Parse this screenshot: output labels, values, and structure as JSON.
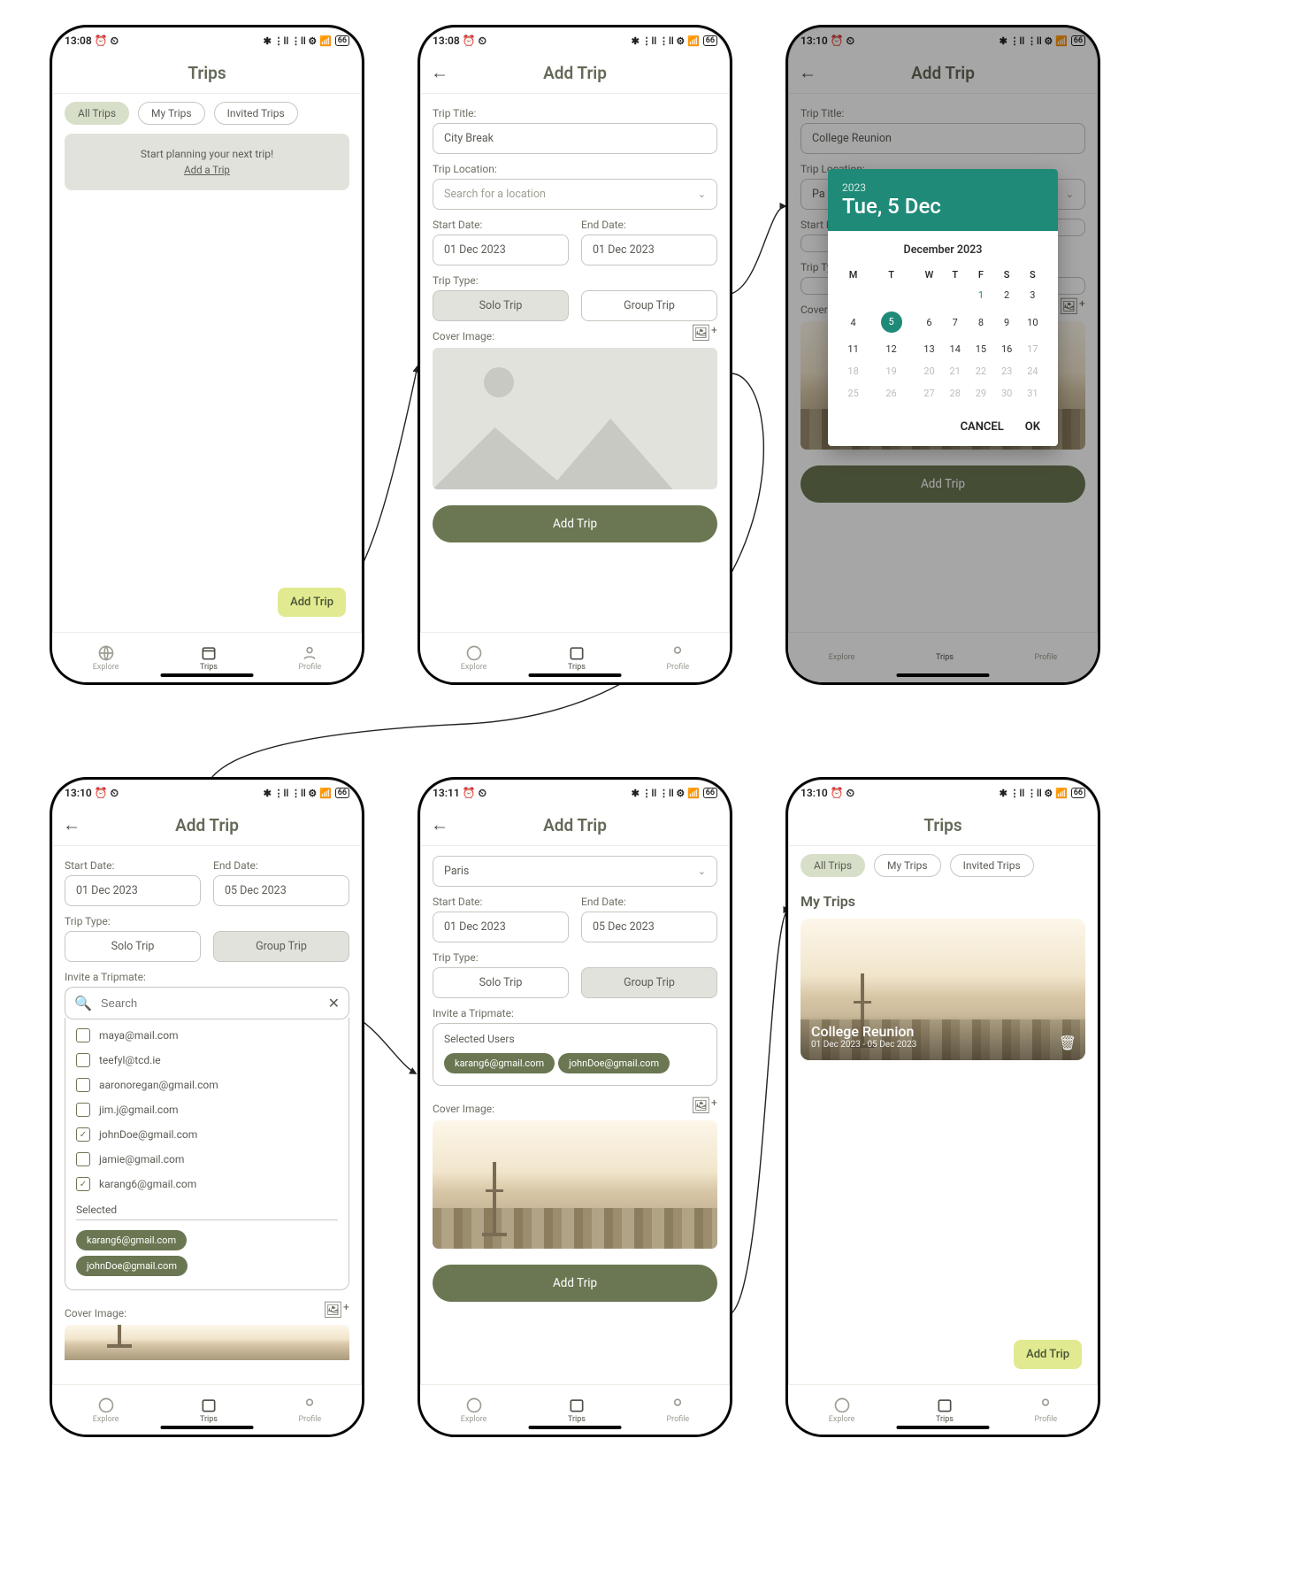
{
  "status": {
    "time1": "13:08",
    "time2": "13:10",
    "time3": "13:11",
    "battery": "66"
  },
  "nav": {
    "explore": "Explore",
    "trips": "Trips",
    "profile": "Profile"
  },
  "trips": {
    "title": "Trips",
    "tabs": {
      "all": "All Trips",
      "my": "My Trips",
      "invited": "Invited Trips"
    },
    "empty_headline": "Start planning your next trip!",
    "empty_link": "Add a Trip",
    "fab": "Add Trip",
    "my_heading": "My Trips",
    "card": {
      "title": "College Reunion",
      "dates": "01 Dec 2023 - 05 Dec 2023"
    }
  },
  "add": {
    "title": "Add Trip",
    "labels": {
      "trip_title": "Trip Title:",
      "trip_location": "Trip Location:",
      "start": "Start Date:",
      "end": "End Date:",
      "type": "Trip Type:",
      "cover": "Cover Image:",
      "invite": "Invite a Tripmate:"
    },
    "values": {
      "title_s2": "City Break",
      "title_s3": "College Reunion",
      "location_placeholder": "Search for a location",
      "location_paris": "Paris",
      "date1": "01 Dec 2023",
      "date5": "05 Dec 2023"
    },
    "types": {
      "solo": "Solo Trip",
      "group": "Group Trip"
    },
    "cta": "Add Trip",
    "search_placeholder": "Search",
    "selected_heading": "Selected",
    "selected_users_heading": "Selected Users",
    "contacts": [
      {
        "email": "maya@mail.com",
        "checked": false
      },
      {
        "email": "teefyl@tcd.ie",
        "checked": false
      },
      {
        "email": "aaronoregan@gmail.com",
        "checked": false
      },
      {
        "email": "jim.j@gmail.com",
        "checked": false
      },
      {
        "email": "johnDoe@gmail.com",
        "checked": true
      },
      {
        "email": "jamie@gmail.com",
        "checked": false
      },
      {
        "email": "karang6@gmail.com",
        "checked": true
      }
    ],
    "selected": [
      "karang6@gmail.com",
      "johnDoe@gmail.com"
    ]
  },
  "picker": {
    "year": "2023",
    "headline": "Tue, 5 Dec",
    "month": "December 2023",
    "dow": [
      "M",
      "T",
      "W",
      "T",
      "F",
      "S",
      "S"
    ],
    "weeks": [
      [
        "",
        "",
        "",
        "",
        "1",
        "2",
        "3"
      ],
      [
        "4",
        "5",
        "6",
        "7",
        "8",
        "9",
        "10"
      ],
      [
        "11",
        "12",
        "13",
        "14",
        "15",
        "16",
        "17"
      ],
      [
        "18",
        "19",
        "20",
        "21",
        "22",
        "23",
        "24"
      ],
      [
        "25",
        "26",
        "27",
        "28",
        "29",
        "30",
        "31"
      ]
    ],
    "selected": "5",
    "cancel": "CANCEL",
    "ok": "OK"
  }
}
